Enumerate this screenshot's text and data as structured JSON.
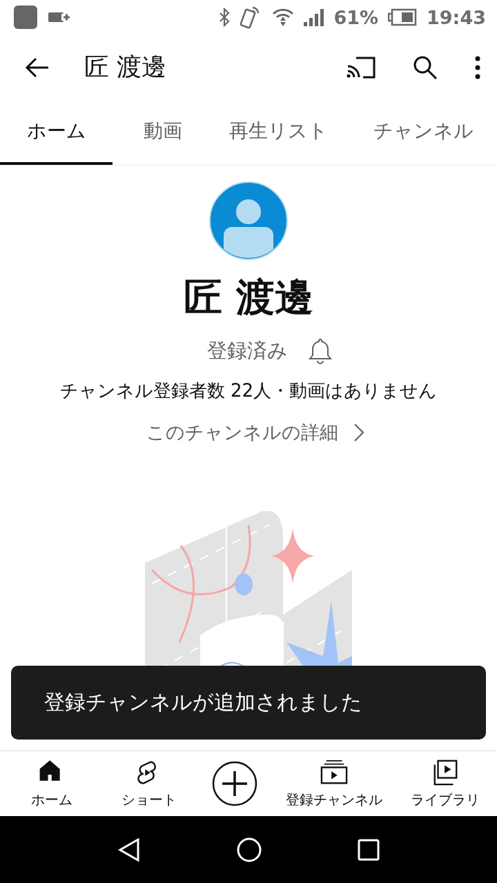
{
  "status_bar": {
    "battery": "61%",
    "time": "19:43"
  },
  "app_bar": {
    "title": "匠 渡邊"
  },
  "tabs": [
    {
      "label": "ホーム",
      "selected": true
    },
    {
      "label": "動画",
      "selected": false
    },
    {
      "label": "再生リスト",
      "selected": false
    },
    {
      "label": "チャンネル",
      "selected": false
    }
  ],
  "channel": {
    "name": "匠 渡邊",
    "subscribe_label": "登録済み",
    "stats": "チャンネル登録者数 22人・動画はありません",
    "details_link": "このチャンネルの詳細"
  },
  "snackbar": {
    "message": "登録チャンネルが追加されました"
  },
  "bottom_nav": [
    {
      "kind": "home",
      "label": "ホーム",
      "selected": true
    },
    {
      "kind": "shorts",
      "label": "ショート",
      "selected": false
    },
    {
      "kind": "create"
    },
    {
      "kind": "subscriptions",
      "label": "登録チャンネル",
      "selected": false
    },
    {
      "kind": "library",
      "label": "ライブラリ",
      "selected": false
    }
  ]
}
